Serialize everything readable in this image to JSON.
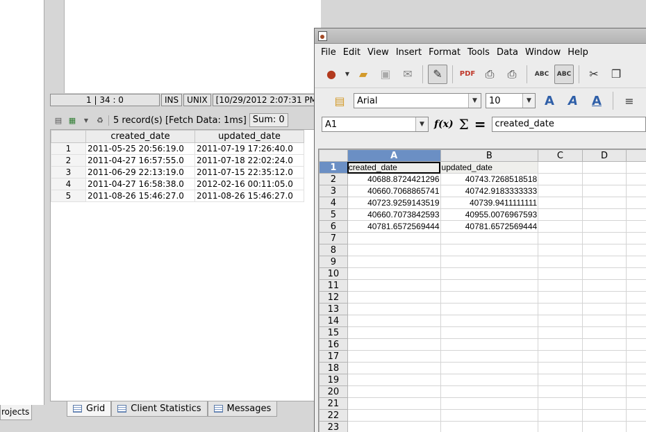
{
  "background_app": {
    "projects_tab": "rojects",
    "status_bar": [
      "1 | 34 : 0",
      "INS",
      "UNIX",
      "[10/29/2012 2:07:31 PM"
    ],
    "result_toolbar": {
      "record_info": "5 record(s) [Fetch Data: 1ms]",
      "sum": "Sum: 0"
    },
    "grid": {
      "columns": [
        "created_date",
        "updated_date"
      ],
      "rows": [
        {
          "num": "1",
          "created": "2011-05-25 20:56:19.0",
          "updated": "2011-07-19 17:26:40.0"
        },
        {
          "num": "2",
          "created": "2011-04-27 16:57:55.0",
          "updated": "2011-07-18 22:02:24.0"
        },
        {
          "num": "3",
          "created": "2011-06-29 22:13:19.0",
          "updated": "2011-07-15 22:35:12.0"
        },
        {
          "num": "4",
          "created": "2011-04-27 16:58:38.0",
          "updated": "2012-02-16 00:11:05.0"
        },
        {
          "num": "5",
          "created": "2011-08-26 15:46:27.0",
          "updated": "2011-08-26 15:46:27.0"
        }
      ]
    },
    "bottom_tabs": [
      "Grid",
      "Client Statistics",
      "Messages"
    ]
  },
  "spreadsheet": {
    "menu": [
      "File",
      "Edit",
      "View",
      "Insert",
      "Format",
      "Tools",
      "Data",
      "Window",
      "Help"
    ],
    "font_name": "Arial",
    "font_size": "10",
    "cell_ref": "A1",
    "formula_content": "created_date",
    "columns": [
      "A",
      "B",
      "C",
      "D"
    ],
    "row_numbers": [
      "1",
      "2",
      "3",
      "4",
      "5",
      "6",
      "7",
      "8",
      "9",
      "10",
      "11",
      "12",
      "13",
      "14",
      "15",
      "16",
      "17",
      "18",
      "19",
      "20",
      "21",
      "22",
      "23"
    ],
    "header_row": {
      "a": "created_date",
      "b": "updated_date"
    },
    "data_rows": [
      {
        "a": "40688.8724421296",
        "b": "40743.7268518518"
      },
      {
        "a": "40660.7068865741",
        "b": "40742.9183333333"
      },
      {
        "a": "40723.9259143519",
        "b": "40739.9411111111"
      },
      {
        "a": "40660.7073842593",
        "b": "40955.0076967593"
      },
      {
        "a": "40781.6572569444",
        "b": "40781.6572569444"
      }
    ]
  },
  "icons": [
    "scissors-icon",
    "copy-icon",
    "sigma-icon",
    "function-wizard-icon",
    "spellcheck-icon",
    "pdf-icon",
    "print-icon",
    "bold-a-icon",
    "italic-a-icon",
    "underline-a-icon",
    "align-left-icon"
  ],
  "colors": {
    "selected_header": "#6b8fc4",
    "header_cell_bg": "#efefec"
  }
}
